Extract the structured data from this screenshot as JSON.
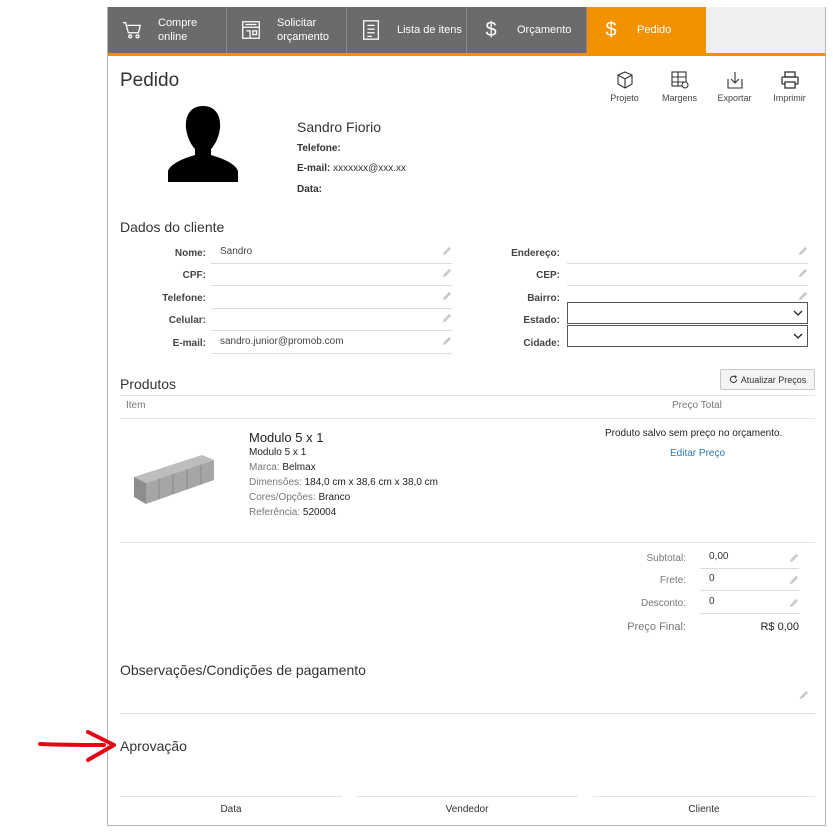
{
  "tabs": [
    {
      "line1": "Compre",
      "line2": "online",
      "icon": "cart-icon"
    },
    {
      "line1": "Solicitar",
      "line2": "orçamento",
      "icon": "store-icon"
    },
    {
      "line1": "Lista de itens",
      "line2": "",
      "icon": "list-icon"
    },
    {
      "line1": "Orçamento",
      "line2": "",
      "icon": "dollar-icon"
    },
    {
      "line1": "Pedido",
      "line2": "",
      "icon": "dollar-icon"
    }
  ],
  "page_title": "Pedido",
  "toolbar": {
    "projeto": "Projeto",
    "margens": "Margens",
    "exportar": "Exportar",
    "imprimir": "Imprimir"
  },
  "customer": {
    "name": "Sandro Fiorio",
    "phone_label": "Telefone:",
    "phone_value": "",
    "email_label": "E-mail:",
    "email_value": "xxxxxxx@xxx.xx",
    "date_label": "Data:",
    "date_value": ""
  },
  "client_section": {
    "title": "Dados do cliente",
    "left_fields": [
      {
        "label": "Nome:",
        "value": "Sandro"
      },
      {
        "label": "CPF:",
        "value": ""
      },
      {
        "label": "Telefone:",
        "value": ""
      },
      {
        "label": "Celular:",
        "value": ""
      },
      {
        "label": "E-mail:",
        "value": "sandro.junior@promob.com"
      }
    ],
    "right_fields": [
      {
        "label": "Endereço:",
        "value": ""
      },
      {
        "label": "CEP:",
        "value": ""
      },
      {
        "label": "Bairro:",
        "value": ""
      },
      {
        "label": "Estado:",
        "value": ""
      },
      {
        "label": "Cidade:",
        "value": ""
      }
    ]
  },
  "products": {
    "title": "Produtos",
    "refresh_label": "Atualizar Preços",
    "col_item": "Item",
    "col_total": "Preço Total",
    "item": {
      "name": "Modulo 5 x 1",
      "subtitle": "Modulo 5 x 1",
      "brand_label": "Marca:",
      "brand": "Belmax",
      "dim_label": "Dimensões:",
      "dimensions": "184,0 cm x 38,6 cm x 38,0 cm",
      "options_label": "Cores/Opções:",
      "options": "Branco",
      "ref_label": "Referência:",
      "reference": "520004",
      "price_message": "Produto salvo sem preço no orçamento.",
      "edit_price": "Editar Preço"
    }
  },
  "totals": {
    "subtotal_label": "Subtotal:",
    "subtotal": "0,00",
    "frete_label": "Frete:",
    "frete": "0",
    "desconto_label": "Desconto:",
    "desconto": "0",
    "final_label": "Preço Final:",
    "final": "R$ 0,00"
  },
  "observations_title": "Observações/Condições de pagamento",
  "approval": {
    "title": "Aprovação",
    "data_label": "Data",
    "vendedor_label": "Vendedor",
    "cliente_label": "Cliente"
  },
  "colors": {
    "accent": "#f39200",
    "tab_bg": "#6b6b6b",
    "link": "#2a7ab8",
    "arrow": "#e30613"
  }
}
